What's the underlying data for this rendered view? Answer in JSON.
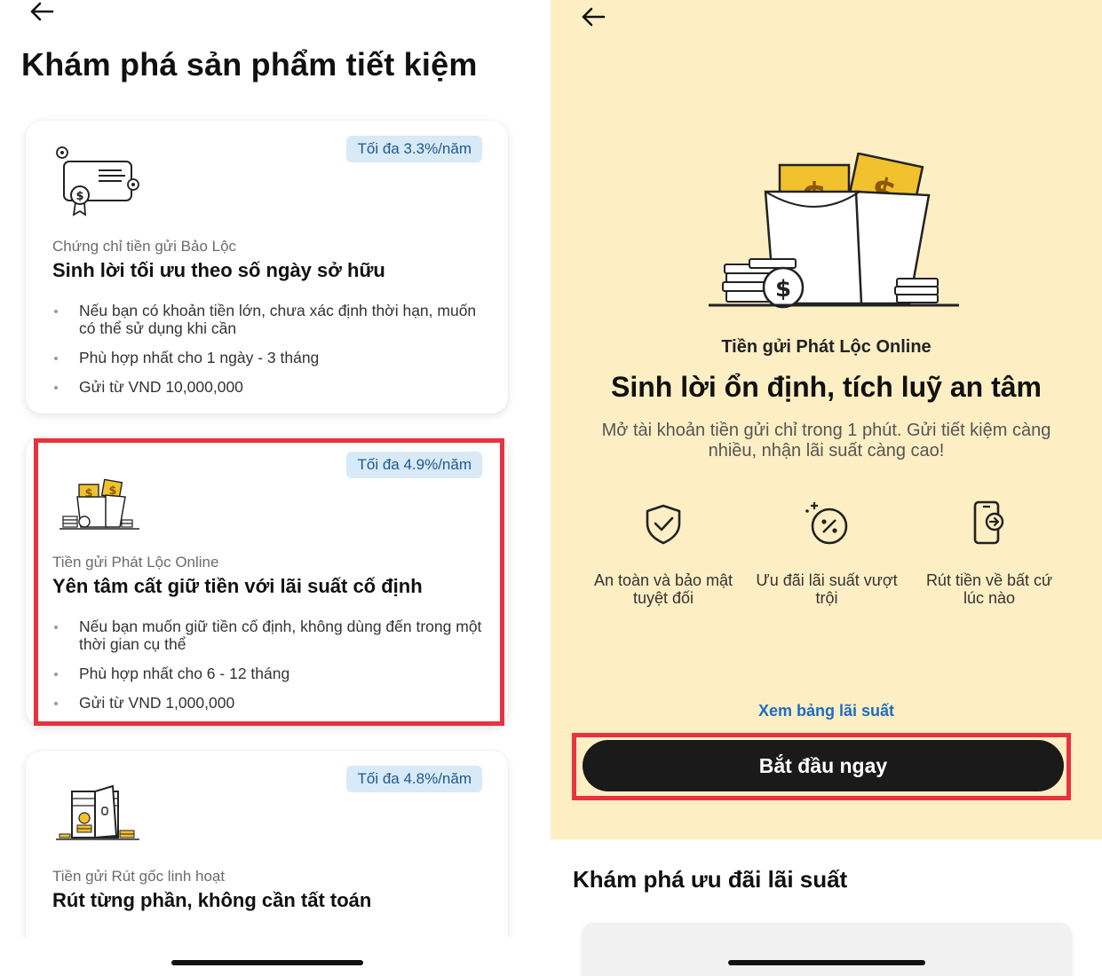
{
  "left_screen": {
    "title": "Khám phá sản phẩm tiết kiệm",
    "cards": [
      {
        "badge": "Tối đa 3.3%/năm",
        "icon": "certificate-icon",
        "subtitle": "Chứng chỉ tiền gửi Bảo Lộc",
        "headline": "Sinh lời tối ưu theo số ngày sở hữu",
        "bullets": [
          "Nếu bạn có khoản tiền lớn, chưa xác định thời hạn, muốn có thể sử dụng khi cần",
          "Phù hợp nhất cho 1 ngày - 3 tháng",
          "Gửi từ VND 10,000,000"
        ]
      },
      {
        "badge": "Tối đa 4.9%/năm",
        "icon": "money-envelope-icon",
        "subtitle": "Tiền gửi Phát Lộc Online",
        "headline": "Yên tâm cất giữ tiền với lãi suất cố định",
        "bullets": [
          "Nếu bạn muốn giữ tiền cố định, không dùng đến trong một thời gian cụ thể",
          "Phù hợp nhất cho 6 - 12 tháng",
          "Gửi từ VND 1,000,000"
        ]
      },
      {
        "badge": "Tối đa 4.8%/năm",
        "icon": "safe-vault-icon",
        "subtitle": "Tiền gửi Rút gốc linh hoạt",
        "headline": "Rút từng phần, không cần tất toán"
      }
    ]
  },
  "right_screen": {
    "product_name": "Tiền gửi Phát Lộc Online",
    "headline": "Sinh lời ổn định, tích luỹ an tâm",
    "description": "Mở tài khoản tiền gửi chỉ trong 1 phút. Gửi tiết kiệm càng nhiều, nhận lãi suất càng cao!",
    "features": [
      {
        "icon": "shield-check-icon",
        "label": "An toàn và bảo mật tuyệt đối"
      },
      {
        "icon": "percent-badge-icon",
        "label": "Ưu đãi lãi suất vượt trội"
      },
      {
        "icon": "phone-withdraw-icon",
        "label": "Rút tiền về bất cứ lúc nào"
      }
    ],
    "rate_link": "Xem bảng lãi suất",
    "cta": "Bắt đầu ngay",
    "section_title": "Khám phá ưu đãi lãi suất"
  },
  "colors": {
    "hero_bg": "#fdeec3",
    "badge_bg": "#d8e9f7",
    "badge_text": "#1d5a8c",
    "highlight": "#e8323f",
    "link": "#1d6cc4",
    "cta_bg": "#1a1a1a",
    "coin_gold": "#f2c12e"
  }
}
